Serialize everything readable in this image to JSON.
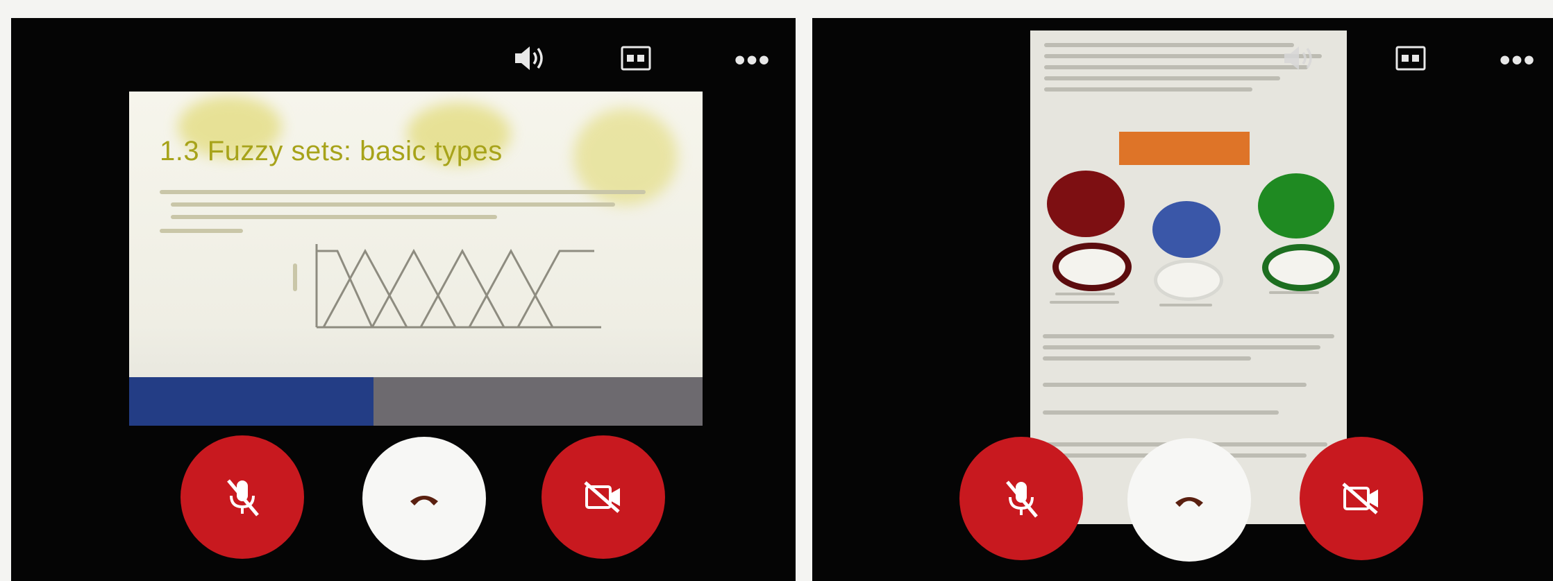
{
  "left_call": {
    "slide": {
      "title": "1.3 Fuzzy sets: basic types"
    },
    "controls": {
      "speaker_icon": "speaker-icon",
      "captions_icon": "closed-captions-icon",
      "more_icon": "more-options-icon",
      "mute_icon": "microphone-off-icon",
      "end_call_icon": "end-call-icon",
      "camera_icon": "camera-off-icon"
    }
  },
  "right_call": {
    "controls": {
      "speaker_icon": "speaker-icon",
      "captions_icon": "closed-captions-icon",
      "more_icon": "more-options-icon",
      "mute_icon": "microphone-off-icon",
      "end_call_icon": "end-call-icon",
      "camera_icon": "camera-off-icon"
    }
  },
  "colors": {
    "panel_bg": "#050505",
    "control_red": "#c8191f",
    "control_white": "#f7f7f5",
    "slide_title": "#a7a31a",
    "slide_footer_blue": "#233d85",
    "doc_orange": "#de7428",
    "token_red": "#7d0f12",
    "token_blue": "#3a57a8",
    "token_green": "#1f8a22"
  }
}
